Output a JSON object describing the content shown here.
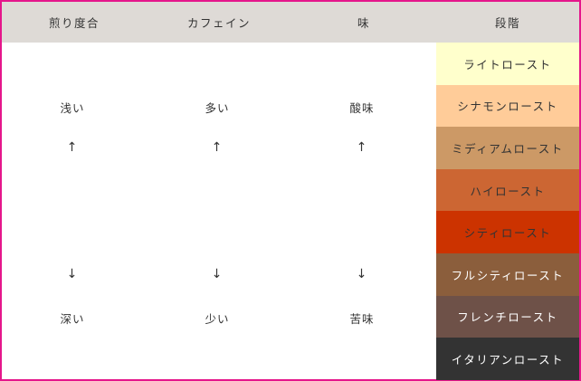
{
  "header": {
    "roast": "煎り度合",
    "caffeine": "カフェイン",
    "taste": "味",
    "stage": "段階"
  },
  "roast": {
    "top": "浅い",
    "bottom": "深い"
  },
  "caffeine": {
    "top": "多い",
    "bottom": "少い"
  },
  "taste": {
    "top": "酸味",
    "bottom": "苦味"
  },
  "arrows": {
    "up": "↑",
    "down": "↓"
  },
  "stages": [
    {
      "label": "ライトロースト",
      "bg": "#ffffcc",
      "color": "#333333"
    },
    {
      "label": "シナモンロースト",
      "bg": "#ffcc99",
      "color": "#333333"
    },
    {
      "label": "ミディアムロースト",
      "bg": "#cc9966",
      "color": "#333333"
    },
    {
      "label": "ハイロースト",
      "bg": "#cc6633",
      "color": "#333333"
    },
    {
      "label": "シティロースト",
      "bg": "#cc3300",
      "color": "#333333"
    },
    {
      "label": "フルシティロースト",
      "bg": "#8b5e3c",
      "color": "#ffffff"
    },
    {
      "label": "フレンチロースト",
      "bg": "#6e5148",
      "color": "#ffffff"
    },
    {
      "label": "イタリアンロースト",
      "bg": "#333333",
      "color": "#ffffff"
    }
  ]
}
